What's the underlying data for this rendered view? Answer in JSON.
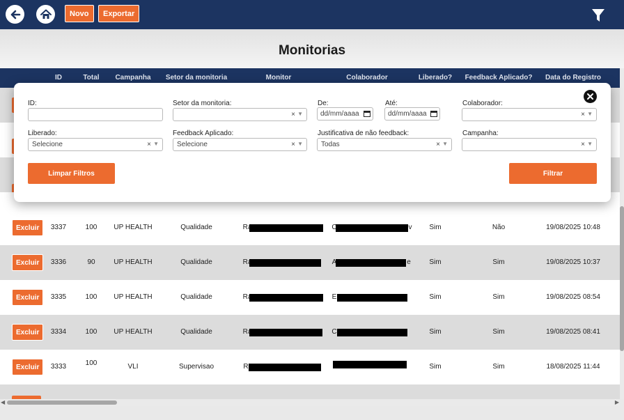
{
  "toolbar": {
    "novo_label": "Novo",
    "exportar_label": "Exportar",
    "back_icon": "arrow-left-icon",
    "home_icon": "home-icon",
    "filter_icon": "funnel-icon"
  },
  "page": {
    "title": "Monitorias"
  },
  "table": {
    "headers": [
      "ID",
      "Total",
      "Campanha",
      "Setor da monitoria",
      "Monitor",
      "Colaborador",
      "Liberado?",
      "Feedback Aplicado?",
      "Data do Registro"
    ],
    "delete_label": "Excluir",
    "rows": [
      {
        "id": "3337",
        "total": "100",
        "campanha": "UP HEALTH",
        "setor": "Qualidade",
        "monitor": "Ra",
        "colaborador": "C",
        "colaborador_tail": "v",
        "liberado": "Sim",
        "feedback": "Não",
        "data": "19/08/2025 10:48"
      },
      {
        "id": "3336",
        "total": "90",
        "campanha": "UP HEALTH",
        "setor": "Qualidade",
        "monitor": "Ra",
        "colaborador": "A",
        "colaborador_tail": "e",
        "liberado": "Sim",
        "feedback": "Sim",
        "data": "19/08/2025 10:37"
      },
      {
        "id": "3335",
        "total": "100",
        "campanha": "UP HEALTH",
        "setor": "Qualidade",
        "monitor": "Ra",
        "colaborador": "E",
        "colaborador_tail": "",
        "liberado": "Sim",
        "feedback": "Sim",
        "data": "19/08/2025 08:54"
      },
      {
        "id": "3334",
        "total": "100",
        "campanha": "UP HEALTH",
        "setor": "Qualidade",
        "monitor": "Ra",
        "colaborador": "C",
        "colaborador_tail": "",
        "liberado": "Sim",
        "feedback": "Sim",
        "data": "19/08/2025 08:41"
      },
      {
        "id": "3333",
        "total": "100",
        "campanha": "VLI",
        "setor": "Supervisao",
        "monitor": "R",
        "colaborador": "",
        "colaborador_tail": "",
        "liberado": "Sim",
        "feedback": "Sim",
        "data": "18/08/2025 11:44"
      }
    ]
  },
  "filters": {
    "id_label": "ID:",
    "id_value": "",
    "setor_label": "Setor da monitoria:",
    "setor_value": "",
    "de_label": "De:",
    "de_placeholder": "dd/mm/aaaa",
    "ate_label": "Até:",
    "ate_placeholder": "dd/mm/aaaa",
    "colaborador_label": "Colaborador:",
    "colaborador_value": "",
    "liberado_label": "Liberado:",
    "liberado_value": "Selecione",
    "feedback_label": "Feedback Aplicado:",
    "feedback_value": "Selecione",
    "justificativa_label": "Justificativa de não feedback:",
    "justificativa_value": "Todas",
    "campanha_label": "Campanha:",
    "campanha_value": "",
    "clear_x": "×",
    "limpar_label": "Limpar Filtros",
    "filtrar_label": "Filtrar"
  },
  "colors": {
    "navy": "#1c3461",
    "accent_orange": "#ec6b2f"
  }
}
